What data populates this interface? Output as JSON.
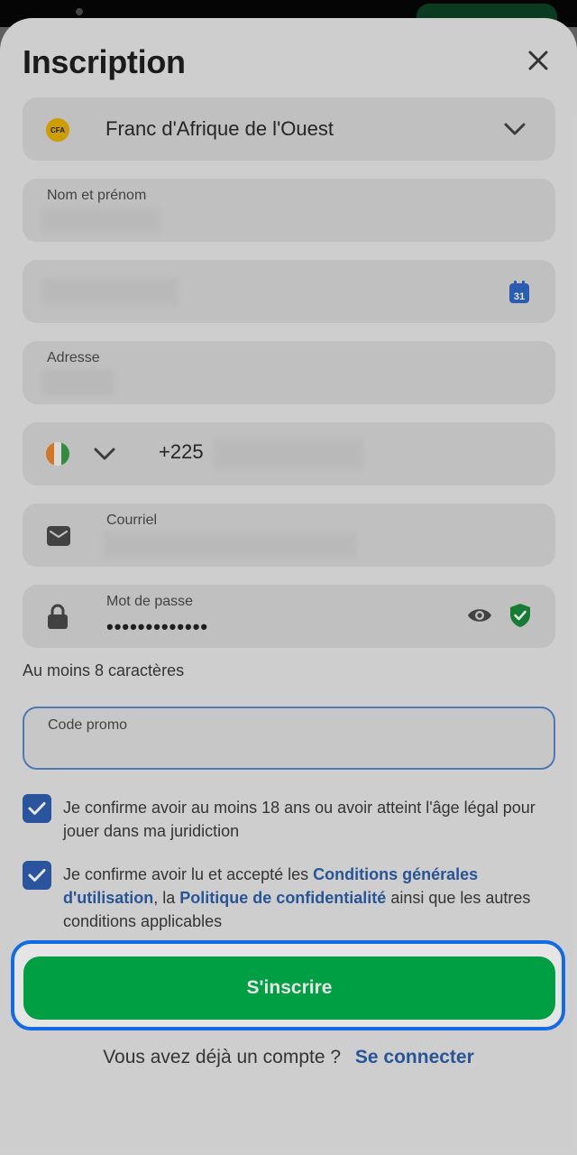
{
  "title": "Inscription",
  "currency": {
    "badge": "CFA",
    "name": "Franc d'Afrique de l'Ouest"
  },
  "fields": {
    "name_label": "Nom et prénom",
    "address_label": "Adresse",
    "phone_prefix": "+225",
    "email_label": "Courriel",
    "password_label": "Mot de passe",
    "password_mask": "•••••••••••••",
    "password_hint": "Au moins 8 caractères",
    "promo_label": "Code promo"
  },
  "calendar_day": "31",
  "consent": {
    "age_text": "Je confirme avoir au moins 18 ans ou avoir atteint l'âge légal pour jouer dans ma juridiction",
    "terms_prefix": "Je confirme avoir lu et accepté les ",
    "terms_link": "Conditions générales d'utilisation",
    "terms_mid": ", la ",
    "privacy_link": "Politique de confidentialité",
    "terms_suffix": " ainsi que les autres conditions applicables"
  },
  "submit_label": "S'inscrire",
  "login": {
    "question": "Vous avez déjà un compte ?",
    "link": "Se connecter"
  },
  "colors": {
    "primary_green": "#00b24c",
    "link_blue": "#2d5fa8",
    "checkbox_blue": "#2f5fb0",
    "focus_blue": "#1677ff",
    "shield_green": "#1b8a3a"
  }
}
